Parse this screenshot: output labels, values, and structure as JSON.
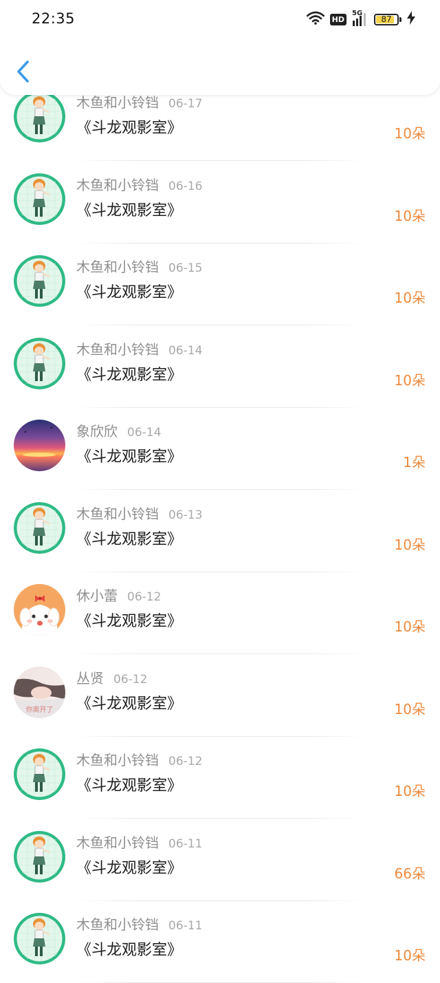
{
  "status_bar": {
    "time": "22:35",
    "hd": "HD",
    "network": "5G",
    "battery": "87",
    "battery_level": 0.87
  },
  "header": {
    "back_icon": "chevron-left-icon"
  },
  "colors": {
    "accent": "#ef8a3d",
    "back": "#3a9be8",
    "name": "#8f8f8f",
    "date": "#a8a8a8"
  },
  "rows": [
    {
      "name": "木鱼和小铃铛",
      "date": "06-17",
      "title": "《斗龙观影室》",
      "amount": "10朵",
      "avatar": "anime-girl"
    },
    {
      "name": "木鱼和小铃铛",
      "date": "06-16",
      "title": "《斗龙观影室》",
      "amount": "10朵",
      "avatar": "anime-girl"
    },
    {
      "name": "木鱼和小铃铛",
      "date": "06-15",
      "title": "《斗龙观影室》",
      "amount": "10朵",
      "avatar": "anime-girl"
    },
    {
      "name": "木鱼和小铃铛",
      "date": "06-14",
      "title": "《斗龙观影室》",
      "amount": "10朵",
      "avatar": "anime-girl"
    },
    {
      "name": "象欣欣",
      "date": "06-14",
      "title": "《斗龙观影室》",
      "amount": "1朵",
      "avatar": "sunset"
    },
    {
      "name": "木鱼和小铃铛",
      "date": "06-13",
      "title": "《斗龙观影室》",
      "amount": "10朵",
      "avatar": "anime-girl"
    },
    {
      "name": "休小蕾",
      "date": "06-12",
      "title": "《斗龙观影室》",
      "amount": "10朵",
      "avatar": "cartoon-dog"
    },
    {
      "name": "丛贤",
      "date": "06-12",
      "title": "《斗龙观影室》",
      "amount": "10朵",
      "avatar": "photo",
      "avatar_caption": "你离开了"
    },
    {
      "name": "木鱼和小铃铛",
      "date": "06-12",
      "title": "《斗龙观影室》",
      "amount": "10朵",
      "avatar": "anime-girl"
    },
    {
      "name": "木鱼和小铃铛",
      "date": "06-11",
      "title": "《斗龙观影室》",
      "amount": "66朵",
      "avatar": "anime-girl"
    },
    {
      "name": "木鱼和小铃铛",
      "date": "06-11",
      "title": "《斗龙观影室》",
      "amount": "10朵",
      "avatar": "anime-girl"
    }
  ]
}
